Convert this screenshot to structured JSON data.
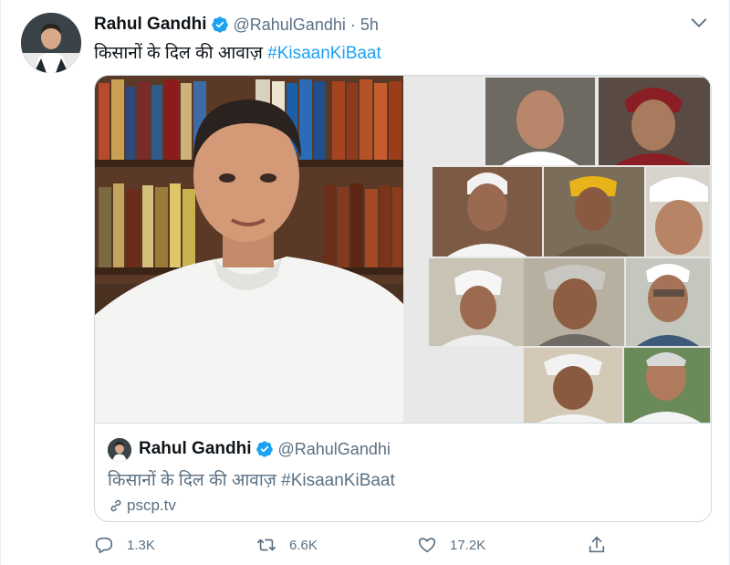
{
  "author": {
    "name": "Rahul Gandhi",
    "handle": "@RahulGandhi",
    "separator": "·",
    "time": "5h",
    "avatar": "avatar-photo",
    "verified_icon": "verified-badge-icon"
  },
  "tweet": {
    "text": "किसानों के दिल की आवाज़",
    "hashtag": "#KisaanKiBaat"
  },
  "media": {
    "description_icon": "video-call-thumbnail"
  },
  "quote": {
    "name": "Rahul Gandhi",
    "handle": "@RahulGandhi",
    "text": "किसानों के दिल की आवाज़ #KisaanKiBaat",
    "link": "pscp.tv"
  },
  "actions": {
    "replies": "1.3K",
    "retweets": "6.6K",
    "likes": "17.2K"
  },
  "colors": {
    "accent": "#1da1f2",
    "secondary_text": "#5b7083",
    "border": "#cfd9de"
  }
}
